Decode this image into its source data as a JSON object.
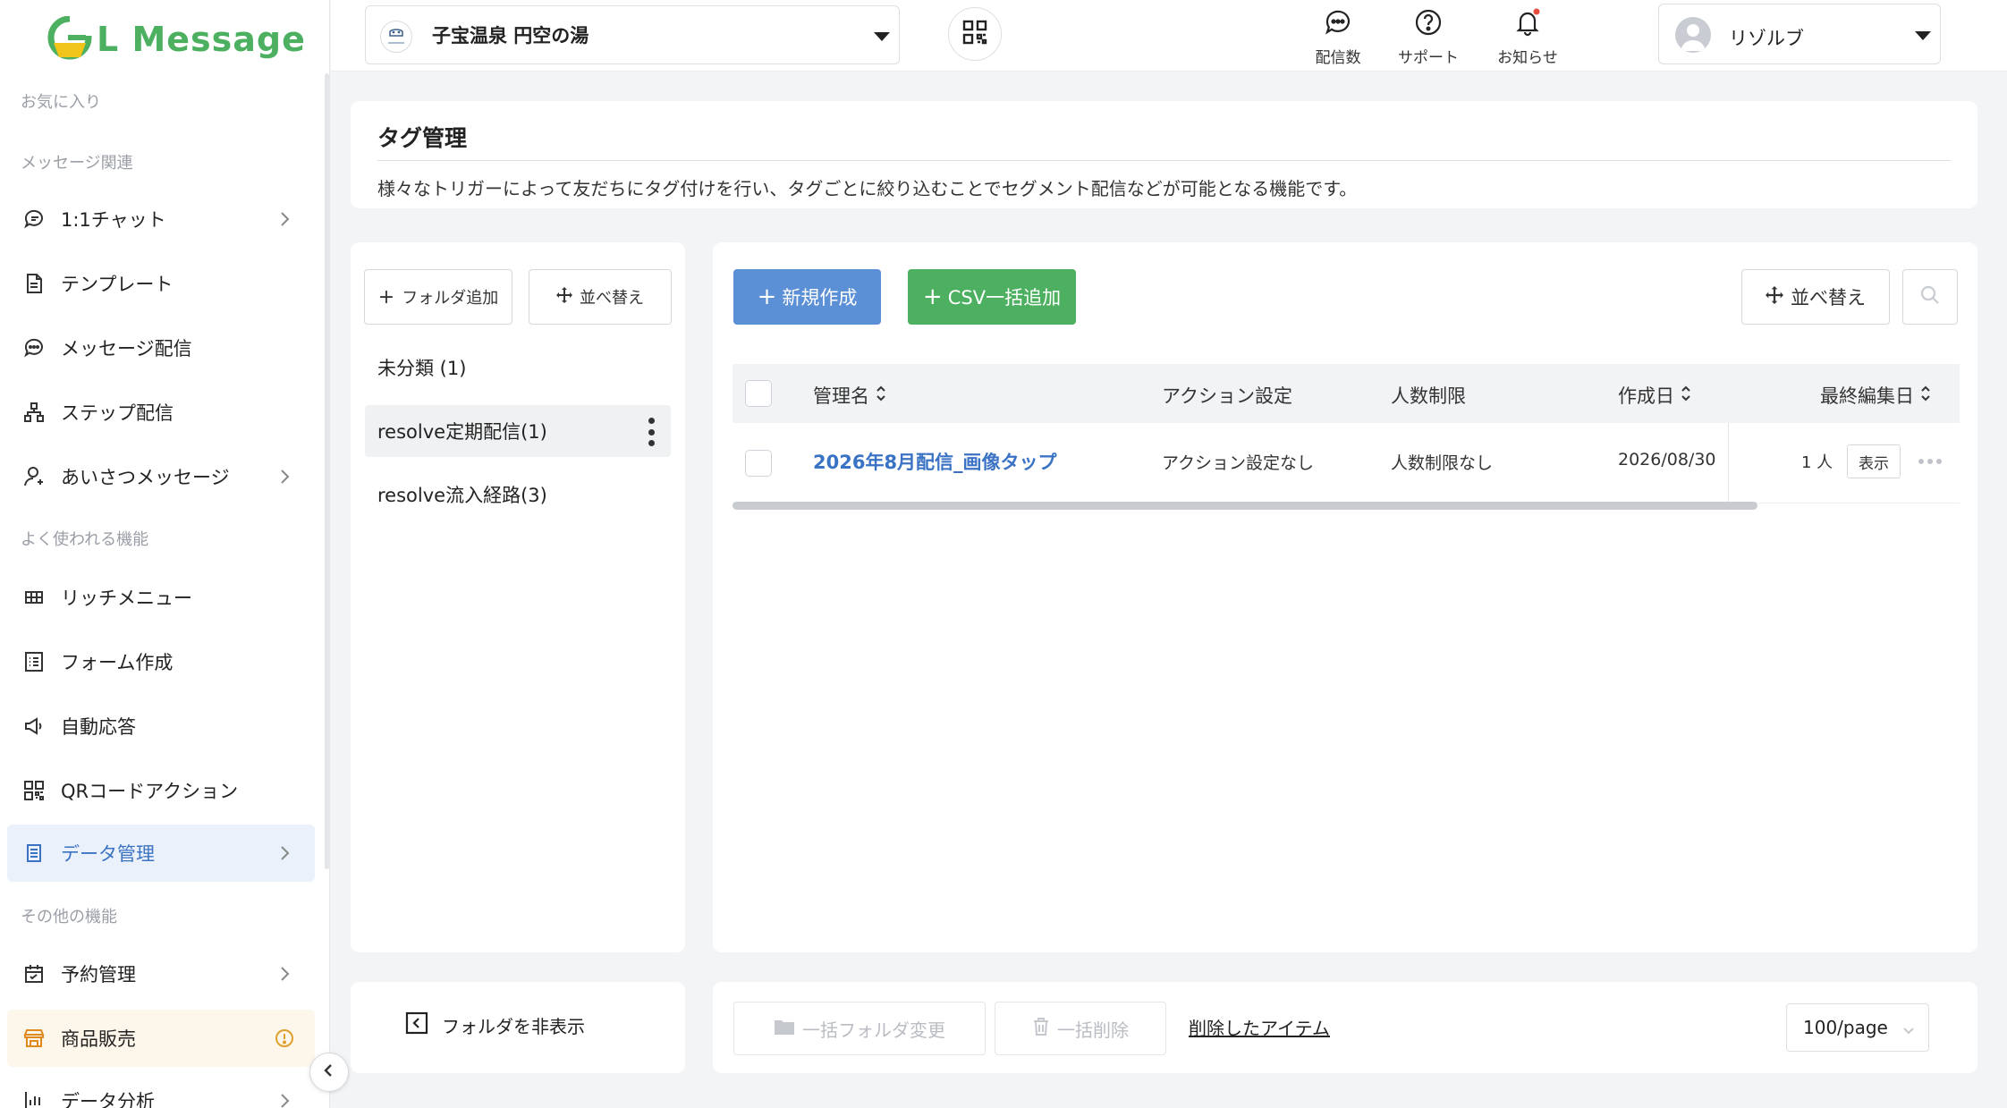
{
  "brand": {
    "name": "L Message",
    "color": "#4cb060"
  },
  "colors": {
    "primary": "#5b8fd6",
    "success": "#4cb060",
    "active_text": "#3b73c4",
    "notification_dot": "#e74c3c"
  },
  "sidebar": {
    "sections": {
      "favorites": "お気に入り",
      "messages": "メッセージ関連",
      "frequent": "よく使われる機能",
      "other": "その他の機能"
    },
    "items": [
      {
        "label": "1:1チャット",
        "icon": "chat-icon",
        "chevron": true
      },
      {
        "label": "テンプレート",
        "icon": "document-icon",
        "chevron": false
      },
      {
        "label": "メッセージ配信",
        "icon": "message-bubble-icon",
        "chevron": false
      },
      {
        "label": "ステップ配信",
        "icon": "step-tree-icon",
        "chevron": false
      },
      {
        "label": "あいさつメッセージ",
        "icon": "user-icon",
        "chevron": true
      },
      {
        "label": "リッチメニュー",
        "icon": "grid-icon",
        "chevron": false
      },
      {
        "label": "フォーム作成",
        "icon": "form-list-icon",
        "chevron": false
      },
      {
        "label": "自動応答",
        "icon": "megaphone-icon",
        "chevron": false
      },
      {
        "label": "QRコードアクション",
        "icon": "qr-icon",
        "chevron": false
      },
      {
        "label": "データ管理",
        "icon": "database-icon",
        "chevron": true,
        "active": true
      },
      {
        "label": "予約管理",
        "icon": "calendar-icon",
        "chevron": true
      },
      {
        "label": "商品販売",
        "icon": "store-icon",
        "chevron": false,
        "warning": true
      },
      {
        "label": "データ分析",
        "icon": "bar-chart-icon",
        "chevron": true
      }
    ]
  },
  "header": {
    "account_name": "子宝温泉 円空の湯",
    "actions": [
      {
        "label": "配信数",
        "icon": "message-count-icon"
      },
      {
        "label": "サポート",
        "icon": "help-icon"
      },
      {
        "label": "お知らせ",
        "icon": "bell-icon"
      }
    ],
    "user_name": "リゾルブ"
  },
  "page": {
    "title": "タグ管理",
    "description": "様々なトリガーによって友だちにタグ付けを行い、タグごとに絞り込むことでセグメント配信などが可能となる機能です。"
  },
  "folders": {
    "add_label": "フォルダ追加",
    "sort_label": "並べ替え",
    "items": [
      {
        "label": "未分類 (1)"
      },
      {
        "label": "resolve定期配信(1)",
        "selected": true
      },
      {
        "label": "resolve流入経路(3)"
      }
    ],
    "hide_label": "フォルダを非表示"
  },
  "toolbar": {
    "new_label": "新規作成",
    "csv_label": "CSV一括追加",
    "sort_label": "並べ替え"
  },
  "table": {
    "columns": [
      "管理名",
      "アクション設定",
      "人数制限",
      "作成日",
      "最終編集日"
    ],
    "rows": [
      {
        "name": "2026年8月配信_画像タップ",
        "action": "アクション設定なし",
        "limit": "人数制限なし",
        "created": "2026/08/30",
        "count": "1 人",
        "view_label": "表示"
      }
    ]
  },
  "footer": {
    "bulk_folder_label": "一括フォルダ変更",
    "bulk_delete_label": "一括削除",
    "deleted_items_label": "削除したアイテム",
    "page_size": "100/page"
  }
}
